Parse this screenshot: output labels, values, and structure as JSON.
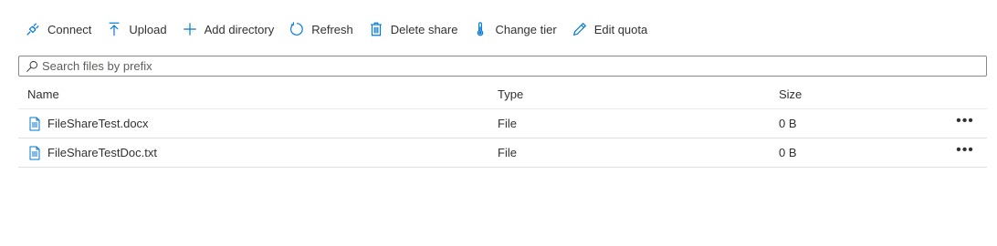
{
  "toolbar": {
    "connect": {
      "label": "Connect",
      "icon": "plug-icon"
    },
    "upload": {
      "label": "Upload",
      "icon": "upload-arrow-icon"
    },
    "add_directory": {
      "label": "Add directory",
      "icon": "plus-icon"
    },
    "refresh": {
      "label": "Refresh",
      "icon": "refresh-icon"
    },
    "delete_share": {
      "label": "Delete share",
      "icon": "trash-icon"
    },
    "change_tier": {
      "label": "Change tier",
      "icon": "thermometer-icon"
    },
    "edit_quota": {
      "label": "Edit quota",
      "icon": "pencil-icon"
    }
  },
  "search": {
    "placeholder": "Search files by prefix",
    "value": ""
  },
  "table": {
    "columns": {
      "name": "Name",
      "type": "Type",
      "size": "Size"
    },
    "rows": [
      {
        "name": "FileShareTest.docx",
        "type": "File",
        "size": "0 B",
        "icon": "document-icon"
      },
      {
        "name": "FileShareTestDoc.txt",
        "type": "File",
        "size": "0 B",
        "icon": "document-icon"
      }
    ],
    "more_label": "•••"
  },
  "colors": {
    "accent": "#0078d4",
    "text": "#323130",
    "border": "#8a8886",
    "divider": "#e1dfdd"
  }
}
